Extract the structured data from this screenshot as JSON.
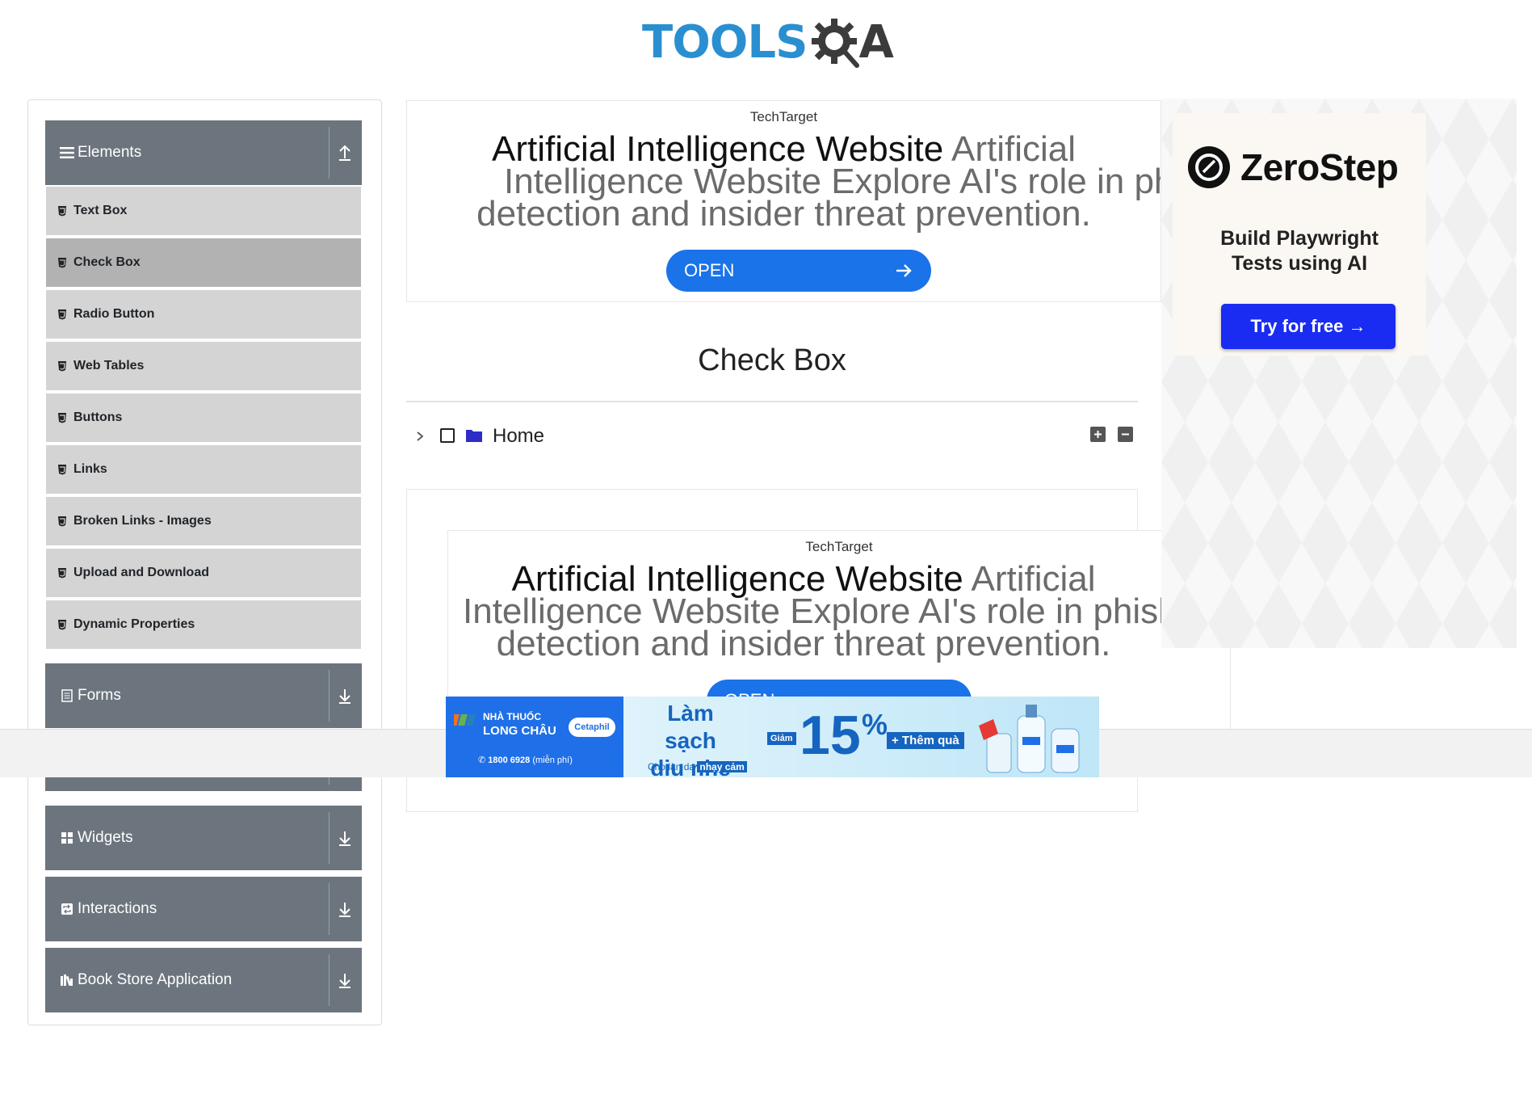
{
  "header": {
    "logo_tools": "TOOLS",
    "logo_qa": "A"
  },
  "sidebar": {
    "groups": [
      {
        "label": "Elements",
        "icon": "hamburger-icon",
        "arrow": "up-arrow-icon"
      },
      {
        "label": "Forms",
        "icon": "form-icon",
        "arrow": "down-arrow-icon"
      },
      {
        "label": "Widgets",
        "icon": "widgets-icon",
        "arrow": "down-arrow-icon"
      },
      {
        "label": "Interactions",
        "icon": "interactions-icon",
        "arrow": "down-arrow-icon"
      },
      {
        "label": "Book Store Application",
        "icon": "book-icon",
        "arrow": "down-arrow-icon"
      }
    ],
    "elements_items": [
      "Text Box",
      "Check Box",
      "Radio Button",
      "Web Tables",
      "Buttons",
      "Links",
      "Broken Links - Images",
      "Upload and Download",
      "Dynamic Properties"
    ],
    "active_item": "Check Box"
  },
  "ad_top": {
    "brand": "TechTarget",
    "line1_strong": "Artificial Intelligence Website",
    "line1_rest": " Artificial",
    "line2": "Intelligence Website Explore AI's role in phishing",
    "line3": "detection and insider threat prevention.",
    "cta": "OPEN"
  },
  "main": {
    "title": "Check Box"
  },
  "tree": {
    "root_label": "Home"
  },
  "ad_mid": {
    "brand": "TechTarget",
    "line1_strong": "Artificial Intelligence Website",
    "line1_rest": " Artificial",
    "line2": "Intelligence Website Explore AI's role in phish",
    "line3": "detection and insider threat prevention.",
    "cta": "OPEN"
  },
  "ad_right": {
    "brand": "ZeroStep",
    "sub1": "Build Playwright",
    "sub2": "Tests using AI",
    "cta": "Try for free →"
  },
  "banner": {
    "store_line1": "NHÀ THUỐC",
    "store_line2": "LONG CHÂU",
    "brand_small": "Cetaphil",
    "phone": "1800 6928",
    "phone_note": "(miễn phí)",
    "headline1": "Làm sạch",
    "headline2": "dịu nhẹ",
    "tagline": "Cho làn da",
    "tagline_hl": "nhạy cảm",
    "discount_label": "Giảm",
    "discount_value": "15",
    "percent": "%",
    "gift": "+ Thêm quà"
  },
  "colors": {
    "sidebar_header": "#6c757d",
    "menu_item": "#d4d4d4",
    "menu_active": "#b2b2b2",
    "accent_blue": "#1a73e8",
    "logo_blue": "#2a8fd0"
  }
}
